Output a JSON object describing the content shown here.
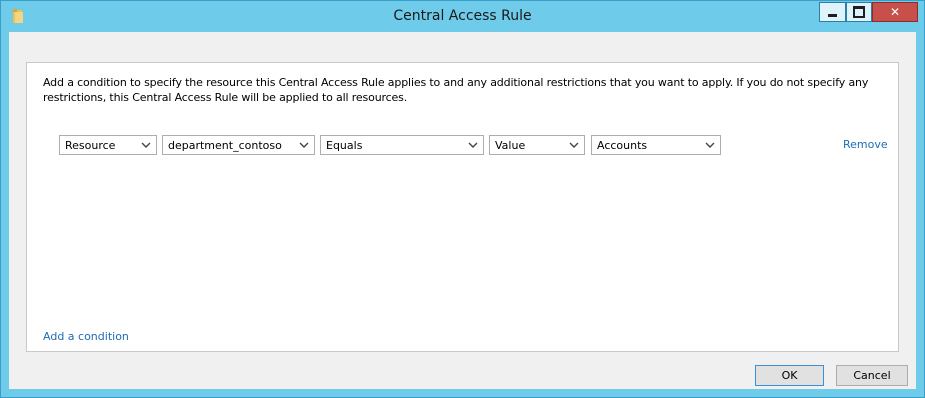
{
  "window": {
    "title": "Central Access Rule"
  },
  "titlebar_icons": {
    "app": "folder-icon",
    "minimize": "minimize-icon",
    "maximize": "maximize-icon",
    "close": "close-icon"
  },
  "description": "Add a condition to specify the resource this Central Access Rule applies to and any additional restrictions that you want to apply. If you do not specify any restrictions, this Central Access Rule will be applied to all resources.",
  "condition": {
    "source": "Resource",
    "attribute": "department_contoso",
    "operator": "Equals",
    "value_type": "Value",
    "value": "Accounts",
    "remove_label": "Remove"
  },
  "add_condition_label": "Add a condition",
  "buttons": {
    "ok": "OK",
    "cancel": "Cancel"
  },
  "colors": {
    "titlebar": "#6ecbea",
    "link": "#1f6bb5",
    "close_button": "#c7504a"
  }
}
